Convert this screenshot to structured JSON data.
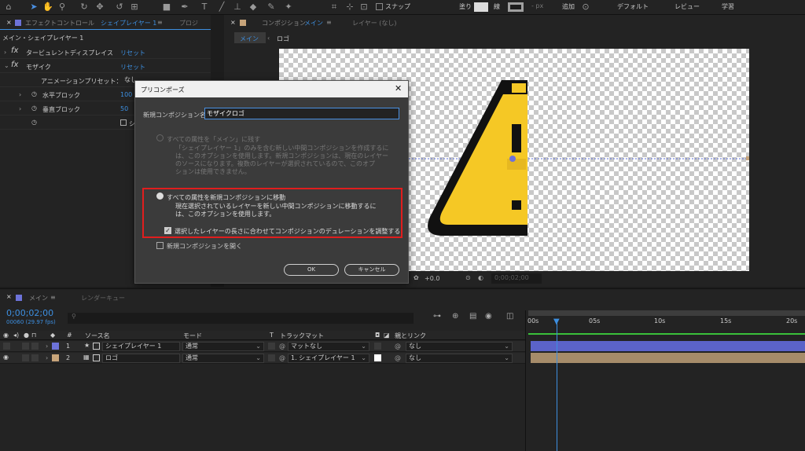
{
  "toolbar": {
    "snap_label": "スナップ",
    "fill_label": "塗り",
    "stroke_label": "線",
    "px_label": "- px",
    "add_label": "追加",
    "workspaces": [
      "デフォルト",
      "レビュー",
      "学習"
    ]
  },
  "effects_panel": {
    "tab_label": "エフェクトコントロール",
    "tab_layer": "シェイプレイヤー 1",
    "tab2_label": "プロジ",
    "breadcrumb": "メイン・シェイプレイヤー 1",
    "effects": [
      {
        "name": "タービュレントディスプレイス",
        "reset": "リセット"
      },
      {
        "name": "モザイク",
        "reset": "リセット"
      }
    ],
    "preset_label": "アニメーションプリセット：",
    "preset_value": "なし",
    "props": [
      {
        "name": "水平ブロック",
        "value": "100"
      },
      {
        "name": "垂直ブロック",
        "value": "50"
      }
    ],
    "checkbox_label": "シ"
  },
  "comp_panel": {
    "tab_label": "コンポジション",
    "tab_name": "メイン",
    "layer_tab": "レイヤー (なし)",
    "crumbs": [
      "メイン",
      "ロゴ"
    ],
    "zoom": "+0.0",
    "timecode": "0;00;02;00"
  },
  "dialog": {
    "title": "プリコンポーズ",
    "name_label": "新規コンポジション名：",
    "name_value": "モザイクロゴ",
    "opt1_label": "すべての属性を「メイン」に残す",
    "opt1_desc": [
      "「シェイプレイヤー 1」のみを含む新しい中間コンポジションを作成するに",
      "は、このオプションを使用します。新規コンポジションは、現在のレイヤー",
      "のソースになります。複数のレイヤーが選択されているので、このオプ",
      "ションは使用できません。"
    ],
    "opt2_label": "すべての属性を新規コンポジションに移動",
    "opt2_desc": [
      "現在選択されているレイヤーを新しい中間コンポジションに移動するに",
      "は、このオプションを使用します。"
    ],
    "adjust_label": "選択したレイヤーの長さに合わせてコンポジションのデュレーションを調整する",
    "open_label": "新規コンポジションを開く",
    "ok_label": "OK",
    "cancel_label": "キャンセル",
    "highlight_color": "#e01e1e"
  },
  "timeline": {
    "tab_label": "メイン",
    "render_tab": "レンダーキュー",
    "timecode": "0;00;02;00",
    "frame_info": "00060 (29.97 fps)",
    "columns": {
      "num": "#",
      "source": "ソース名",
      "mode": "モード",
      "t": "T",
      "trackmatte": "トラックマット",
      "parent": "親とリンク"
    },
    "ruler": [
      "00s",
      "05s",
      "10s",
      "15s",
      "20s"
    ],
    "layers": [
      {
        "num": "1",
        "name": "シェイプレイヤー 1",
        "mode": "通常",
        "matte": "マットなし",
        "parent": "なし",
        "color": "#6d73d9"
      },
      {
        "num": "2",
        "name": "ロゴ",
        "mode": "通常",
        "matte": "1. シェイプレイヤー 1",
        "parent": "なし",
        "color": "#c7a47a"
      }
    ]
  }
}
